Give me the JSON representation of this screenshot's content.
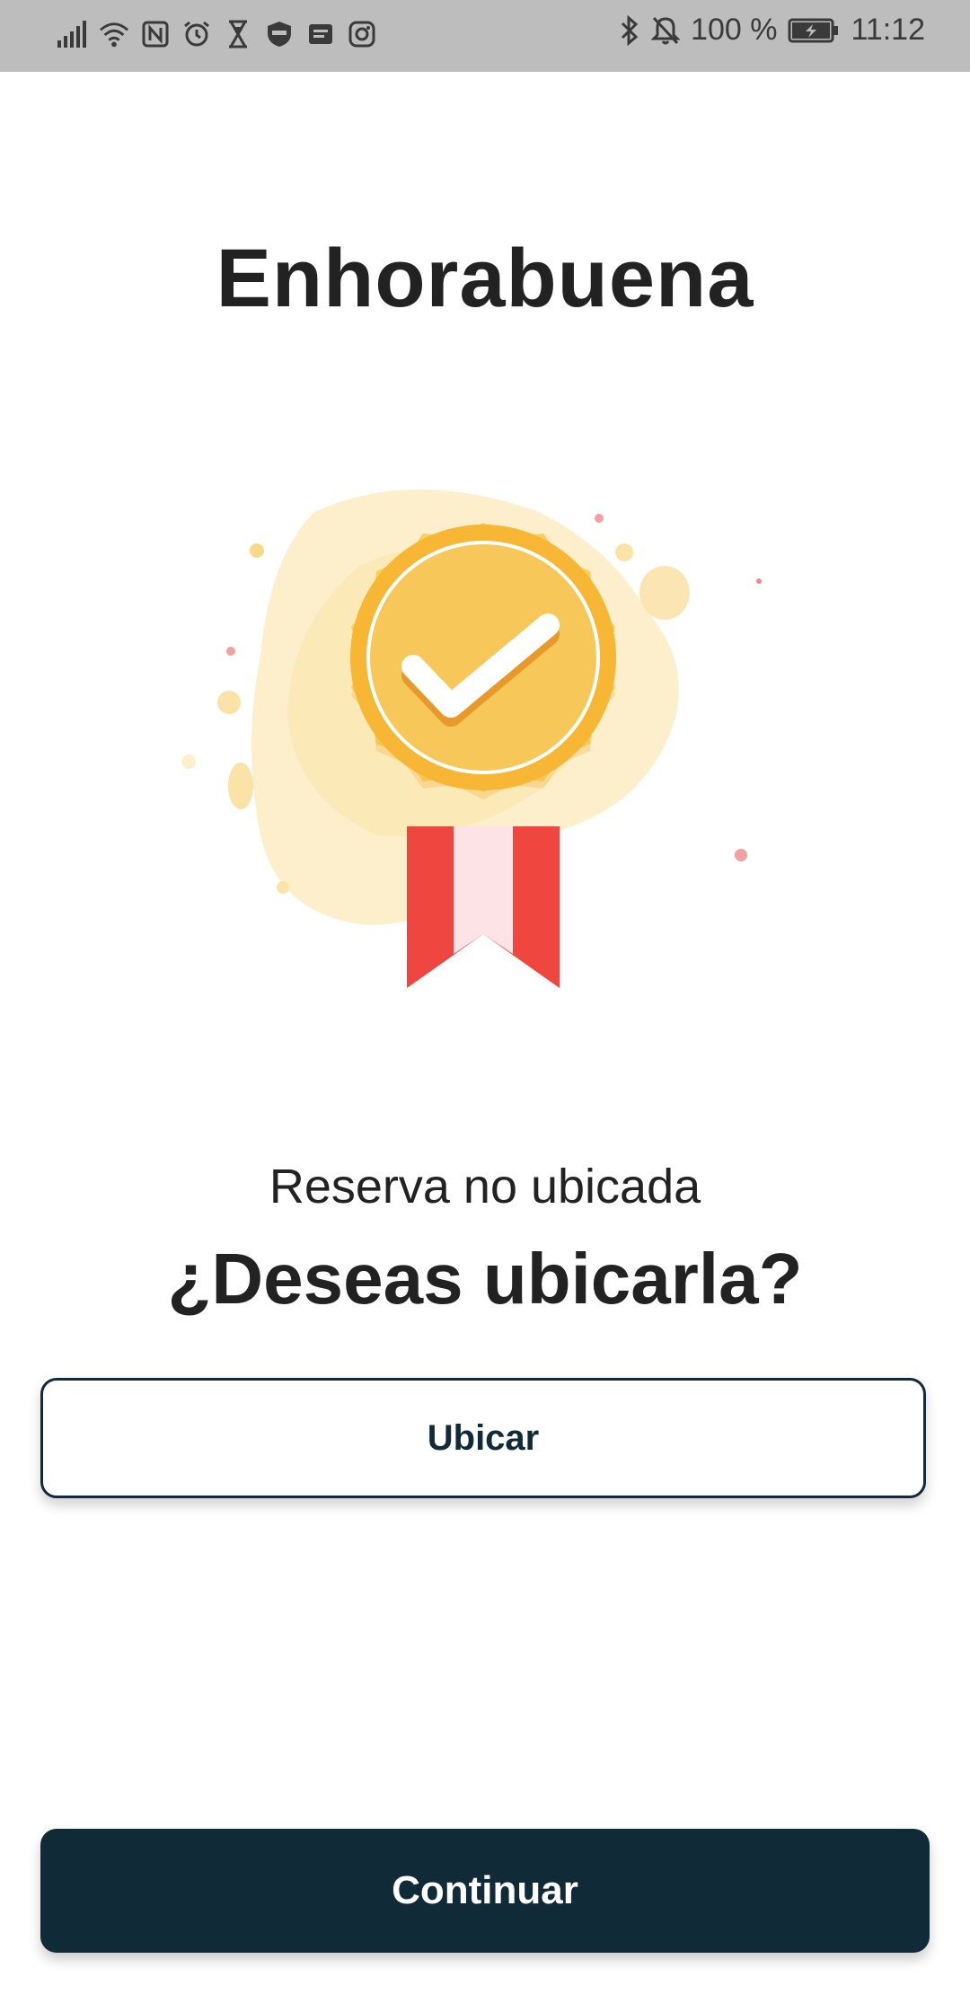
{
  "status_bar": {
    "battery": "100 %",
    "time": "11:12",
    "left_icons": [
      "signal-icon",
      "wifi-icon",
      "nfc-icon",
      "alarm-icon",
      "hourglass-icon",
      "shield-badge-icon",
      "message-icon",
      "instagram-icon"
    ],
    "right_icons": [
      "bluetooth-icon",
      "bell-off-icon",
      "battery-charging-icon"
    ]
  },
  "main": {
    "title": "Enhorabuena",
    "illustration": "award-medal-check-icon",
    "subtitle": "Reserva no ubicada",
    "question": "¿Deseas ubicarla?"
  },
  "buttons": {
    "ubicar_label": "Ubicar",
    "continuar_label": "Continuar"
  },
  "colors": {
    "primary": "#102a38",
    "medal_gold": "#f5c04a",
    "ribbon_red": "#ef4740",
    "status_bar_bg": "#bdbdbd"
  }
}
